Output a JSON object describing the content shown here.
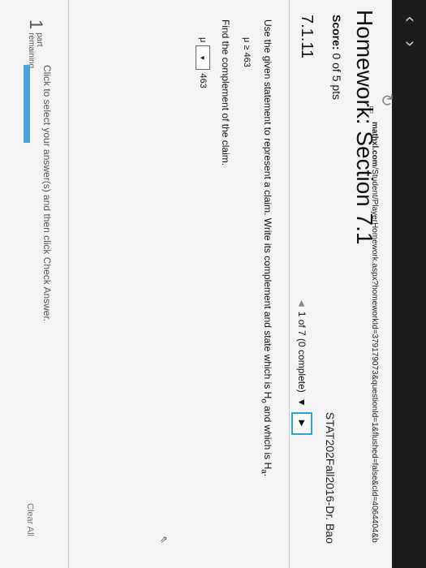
{
  "browser": {
    "url_host": "mathxl.com",
    "url_path": "/Student/PlayerHomework.aspx?homeworkId=379179073&questionId=1&flushed=false&cId=4064404&b"
  },
  "course": "STAT202Fall2016-Dr. Bao",
  "title": "Homework: Section 7.1",
  "score": {
    "label": "Score:",
    "value": "0 of 5 pts"
  },
  "question_number": "7.1.11",
  "progress": {
    "text": "1 of 7 (0 complete)"
  },
  "question": {
    "instruction_pre": "Use the given statement to represent a claim. Write its complement and state which is H",
    "sub_o": "o",
    "instruction_mid": " and which is H",
    "sub_a": "a",
    "instruction_post": ".",
    "claim": "μ ≥ 463",
    "find": "Find the complement of the claim.",
    "answer_symbol": "μ",
    "answer_value": "463"
  },
  "footer": {
    "hint": "Click to select your answer(s) and then click Check Answer.",
    "parts_count": "1",
    "parts_label_1": "part",
    "parts_label_2": "remaining",
    "clear_all": "Clear All"
  },
  "colors": {
    "accent": "#2aa8d0",
    "part_bar": "#4aa6dd"
  }
}
